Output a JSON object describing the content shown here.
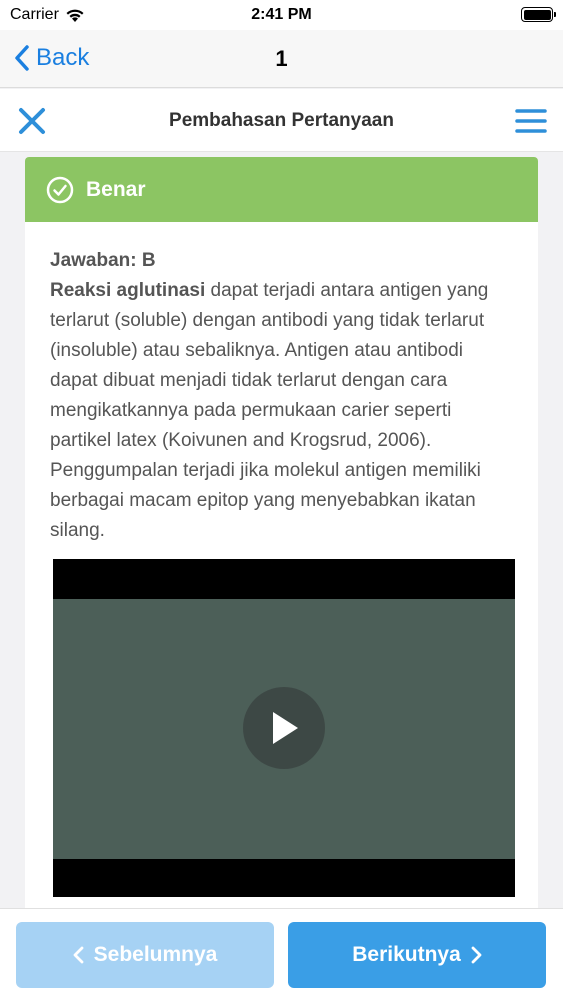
{
  "status_bar": {
    "carrier": "Carrier",
    "time": "2:41 PM"
  },
  "nav": {
    "back_label": "Back",
    "title": "1"
  },
  "header": {
    "title": "Pembahasan Pertanyaan"
  },
  "result": {
    "label": "Benar",
    "color": "#8cc563"
  },
  "explanation": {
    "answer": "Jawaban: B",
    "term": "Reaksi aglutinasi",
    "text": " dapat terjadi antara antigen yang terlarut (soluble) dengan antibodi yang tidak terlarut (insoluble) atau sebaliknya. Antigen atau antibodi dapat dibuat menjadi tidak terlarut dengan cara mengikatkannya pada permukaan carier seperti partikel latex (Koivunen and Krogsrud, 2006). Penggumpalan terjadi jika molekul antigen memiliki berbagai macam epitop yang menyebabkan ikatan silang."
  },
  "footer": {
    "prev_label": "Sebelumnya",
    "next_label": "Berikutnya"
  },
  "colors": {
    "accent": "#1a7fe0",
    "button_prev": "#a6d2f4",
    "button_next": "#3a9ee6"
  }
}
